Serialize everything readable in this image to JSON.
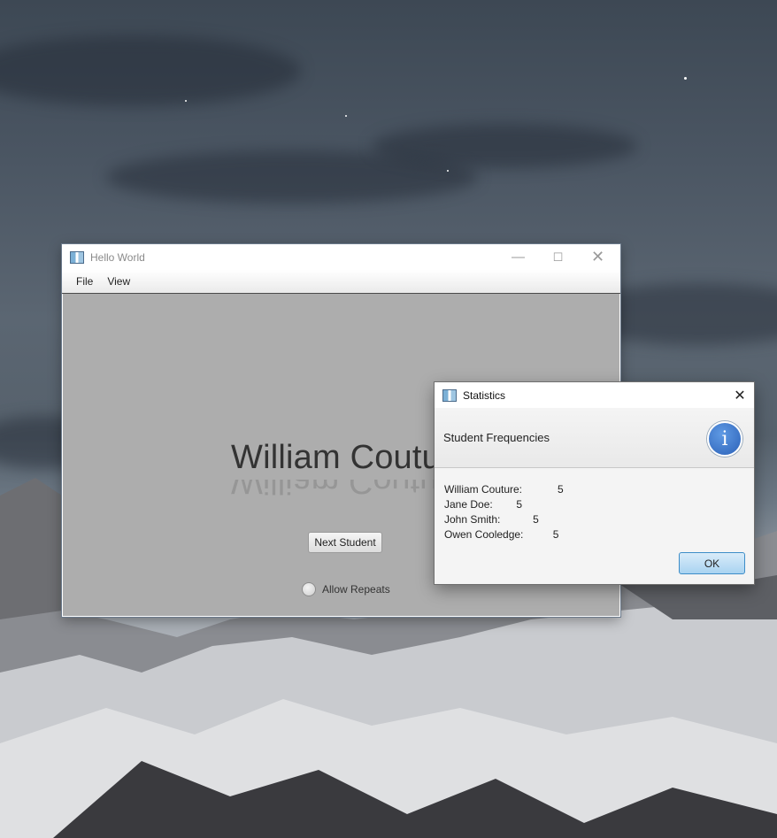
{
  "main_window": {
    "title": "Hello World",
    "menu": [
      "File",
      "View"
    ],
    "student_name": "William Couture",
    "next_button": "Next Student",
    "allow_repeats_label": "Allow Repeats",
    "allow_repeats_checked": false
  },
  "dialog": {
    "title": "Statistics",
    "heading": "Student Frequencies",
    "info_icon": "info-icon",
    "rows": [
      {
        "label": "William Couture:",
        "spacer": "            ",
        "count": "5"
      },
      {
        "label": "Jane Doe:",
        "spacer": "        ",
        "count": "5"
      },
      {
        "label": "John Smith:",
        "spacer": "           ",
        "count": "5"
      },
      {
        "label": "Owen Cooledge:",
        "spacer": "          ",
        "count": "5"
      }
    ],
    "ok_button": "OK"
  },
  "colors": {
    "content_bg": "#adadad",
    "ok_button": "#a9d3f1",
    "info_icon": "#2b61b8"
  }
}
